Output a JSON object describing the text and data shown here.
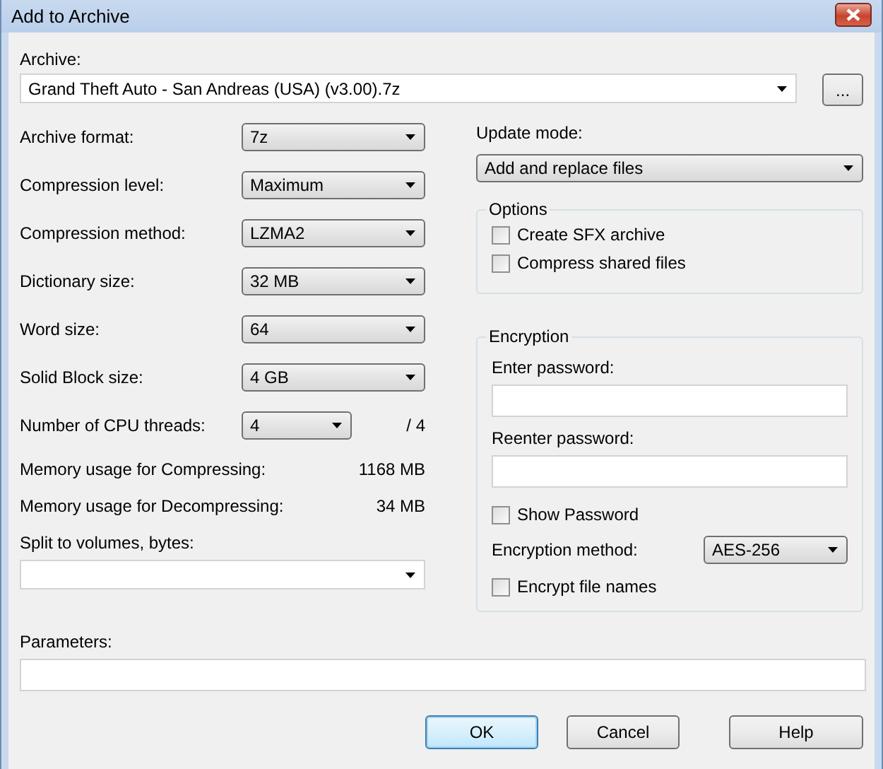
{
  "window": {
    "title": "Add to Archive"
  },
  "archive": {
    "label": "Archive:",
    "value": "Grand Theft Auto - San Andreas (USA) (v3.00).7z",
    "browse": "..."
  },
  "settings": [
    {
      "label": "Archive format:",
      "value": "7z"
    },
    {
      "label": "Compression level:",
      "value": "Maximum"
    },
    {
      "label": "Compression method:",
      "value": "LZMA2"
    },
    {
      "label": "Dictionary size:",
      "value": "32 MB"
    },
    {
      "label": "Word size:",
      "value": "64"
    },
    {
      "label": "Solid Block size:",
      "value": "4 GB"
    },
    {
      "label": "Number of CPU threads:",
      "value": "4",
      "max": "/ 4"
    }
  ],
  "memory": [
    {
      "label": "Memory usage for Compressing:",
      "value": "1168 MB"
    },
    {
      "label": "Memory usage for Decompressing:",
      "value": "34 MB"
    }
  ],
  "split": {
    "label": "Split to volumes, bytes:"
  },
  "update_mode": {
    "label": "Update mode:",
    "value": "Add and replace files"
  },
  "options": {
    "title": "Options",
    "items": [
      {
        "label": "Create SFX archive",
        "checked": false
      },
      {
        "label": "Compress shared files",
        "checked": false
      }
    ]
  },
  "encryption": {
    "title": "Encryption",
    "password_label": "Enter password:",
    "reenter_label": "Reenter password:",
    "show_password": {
      "label": "Show Password",
      "checked": false
    },
    "method": {
      "label": "Encryption method:",
      "value": "AES-256"
    },
    "encrypt_names": {
      "label": "Encrypt file names",
      "checked": false
    }
  },
  "parameters": {
    "label": "Parameters:"
  },
  "buttons": [
    {
      "label": "OK",
      "default": true
    },
    {
      "label": "Cancel",
      "default": false
    },
    {
      "label": "Help",
      "default": false
    }
  ]
}
